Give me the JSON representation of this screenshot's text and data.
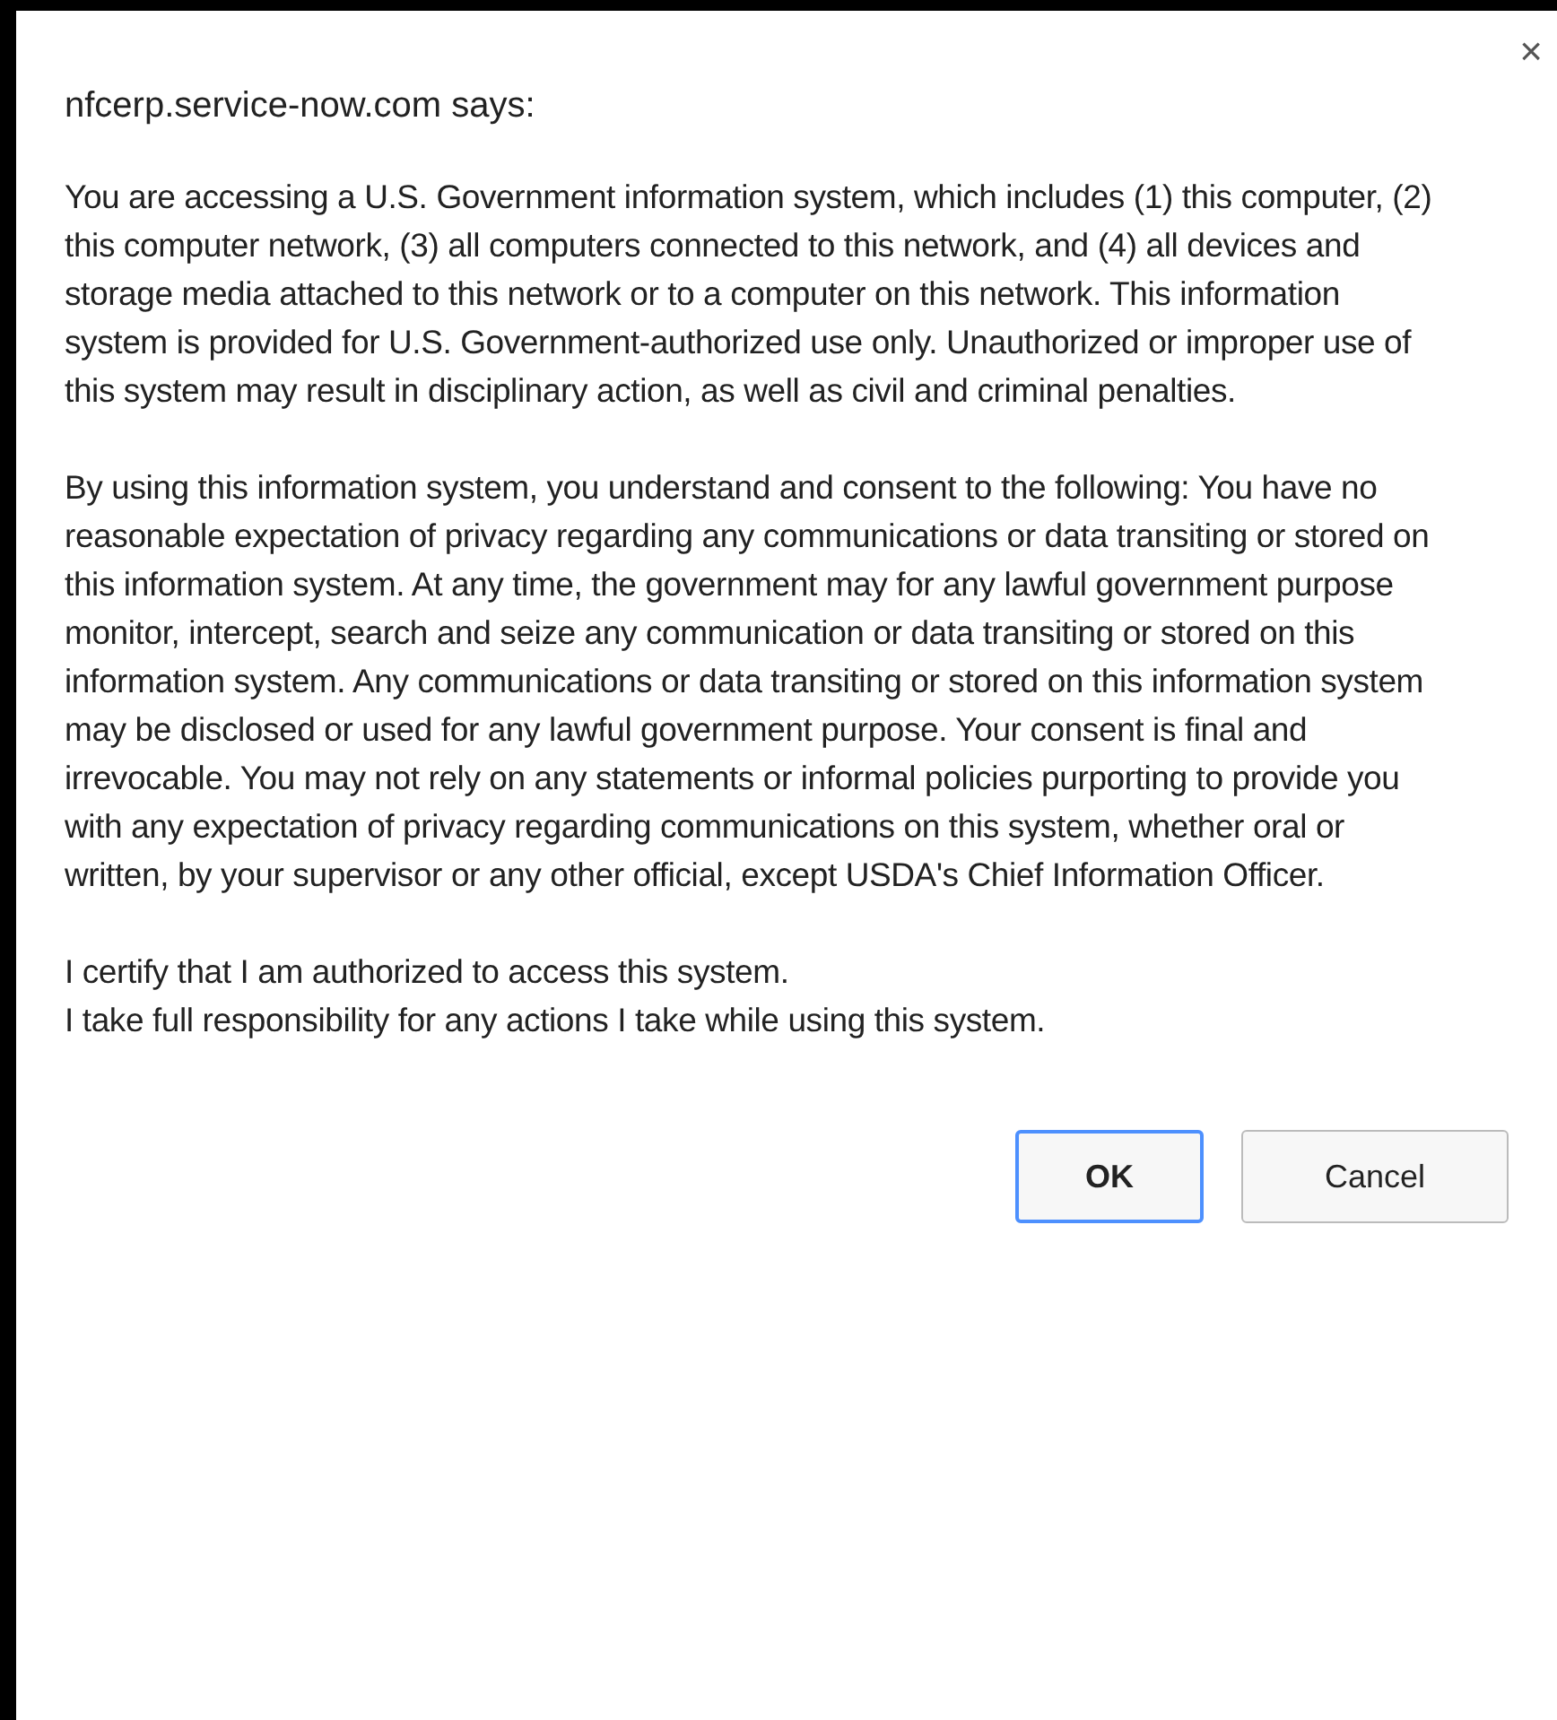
{
  "dialog": {
    "title": "nfcerp.service-now.com says:",
    "close": "×",
    "paragraphs": [
      "You are accessing a U.S. Government information system, which includes (1) this computer, (2) this computer network, (3) all computers connected to this network, and (4) all devices and storage media attached to this network or to a computer on this network. This information system is provided for U.S. Government-authorized use only. Unauthorized or improper use of this system may result in disciplinary action, as well as civil and criminal penalties.",
      "By using this information system, you understand and consent to the following: You have no reasonable expectation of privacy regarding any communications or data transiting or stored on this information system. At any time, the government may for any lawful government purpose monitor, intercept, search and seize any communication or data transiting or stored on this information system. Any communications or data transiting or stored on this information system may be disclosed or used for any lawful government purpose. Your consent is final and irrevocable. You may not rely on any statements or informal policies purporting to provide you with any expectation of privacy regarding communications on this system, whether oral or written, by your supervisor or any other official, except USDA's Chief Information Officer."
    ],
    "certifications": [
      "I certify that I am authorized to access this system.",
      "I take full responsibility for any actions I take while using this system."
    ],
    "buttons": [
      {
        "label": "OK",
        "selected": true
      },
      {
        "label": "Cancel",
        "selected": false
      }
    ]
  }
}
